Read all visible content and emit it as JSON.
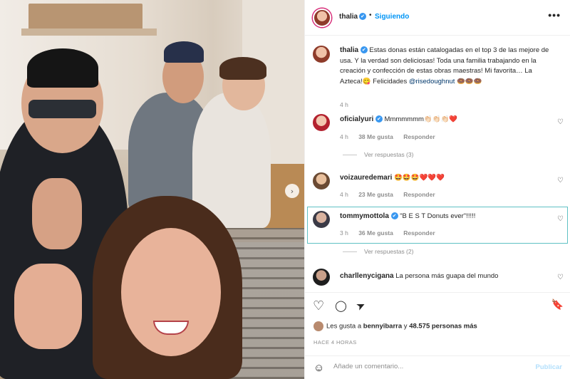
{
  "colors": {
    "accent": "#0095f6",
    "verified": "#3897f0",
    "highlight": "#5fc1c4",
    "muted": "#8e8e8e",
    "post_disabled": "#b2dffc"
  },
  "header": {
    "username": "thalia",
    "verified_icon": "✔",
    "separator": "•",
    "follow_label": "Siguiendo",
    "more_icon": "•••"
  },
  "photo": {
    "next_icon": "›"
  },
  "caption": {
    "username": "thalia",
    "text": "Estas donas están catalogadas en el top 3 de las mejore de usa. Y la verdad son deliciosas! Toda una familia trabajando en la creación y confección de estas obras maestras! Mi favorita… La Azteca!😋 Felicidades ",
    "mention": "@risedoughnut",
    "emojis": " 🍩🍩🍩",
    "time": "4 h"
  },
  "comments": [
    {
      "username": "oficialyuri",
      "text": "Mmmmmmm👏🏻👏🏻👏🏻❤️",
      "time": "4 h",
      "likes": "38 Me gusta",
      "reply": "Responder",
      "replies": "Ver respuestas (3)"
    },
    {
      "username": "voizauredemari",
      "text": "🤩🤩🤩❤️❤️❤️",
      "time": "4 h",
      "likes": "23 Me gusta",
      "reply": "Responder",
      "replies": ""
    },
    {
      "username": "tommymottola",
      "text": "\"B E S T Donuts ever\"!!!!!",
      "time": "3 h",
      "likes": "36 Me gusta",
      "reply": "Responder",
      "replies": "Ver respuestas (2)"
    },
    {
      "username": "charllenycigana",
      "text": "La persona más guapa del mundo",
      "time": "",
      "likes": "",
      "reply": "",
      "replies": ""
    }
  ],
  "actions": {
    "like_icon": "♡",
    "comment_icon": "◯",
    "share_icon": "➤",
    "save_icon": "🔖",
    "likes_prefix": "Les gusta a ",
    "likes_user": "bennyibarra",
    "likes_middle": " y ",
    "likes_count": "48.575 personas más",
    "time": "HACE 4 HORAS"
  },
  "composer": {
    "emoji_icon": "☺",
    "placeholder": "Añade un comentario...",
    "post_label": "Publicar"
  }
}
